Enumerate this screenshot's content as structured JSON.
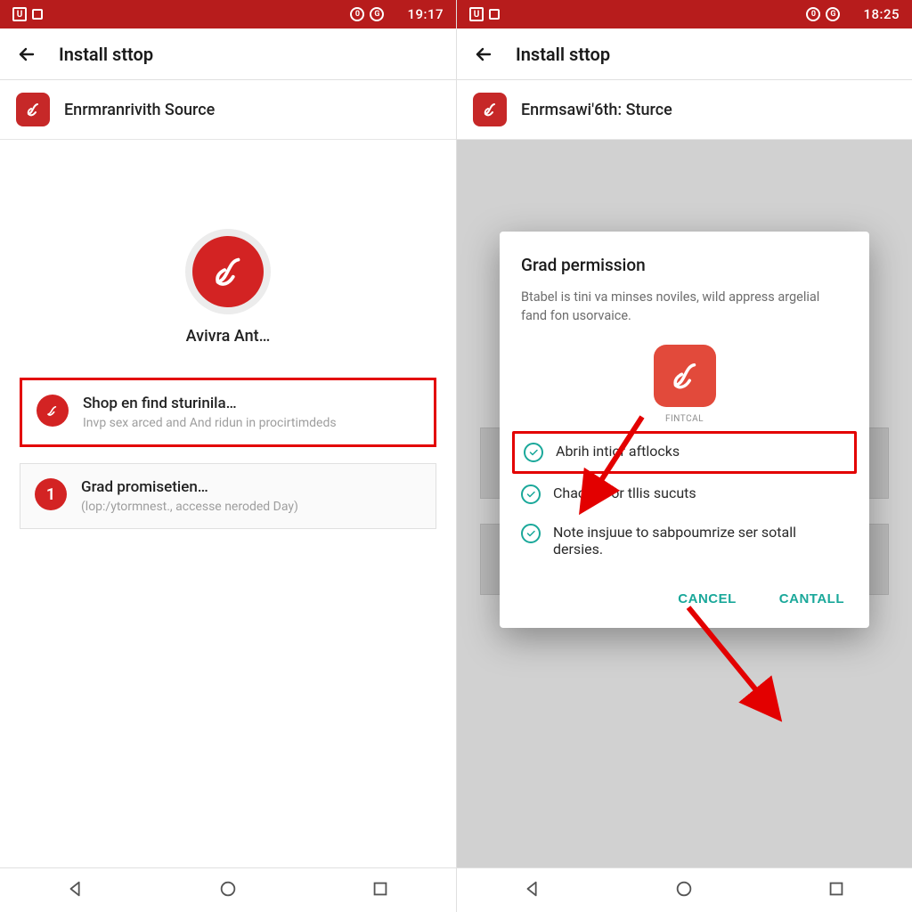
{
  "colors": {
    "status_bg": "#b71c1c",
    "brand": "#d32323",
    "highlight": "#e30000",
    "accent": "#1aa89a"
  },
  "left": {
    "status_time": "19:17",
    "header_title": "Install sttop",
    "source_label": "Enrmranrivith Source",
    "app_name": "Avivra Ant…",
    "cards": [
      {
        "title": "Shop en find sturinila…",
        "subtitle": "Invp sex arced and And ridun in procirtimdeds",
        "highlighted": true,
        "icon": "swirl"
      },
      {
        "title": "Grad promisetien…",
        "subtitle": "(lop:/ytormnest., accesse neroded Day)",
        "highlighted": false,
        "icon": "1"
      }
    ]
  },
  "right": {
    "status_time": "18:25",
    "header_title": "Install sttop",
    "source_label": "Enrmsawi'6th: Sturce",
    "dialog": {
      "title": "Grad permission",
      "desc": "Btabel is tini va minses noviles, wild appress argelial fand fon usorvaice.",
      "icon_caption": "FINTCAL",
      "perms": [
        {
          "label": "Abrih intior aftlocks",
          "highlighted": true
        },
        {
          "label": "Chacleal or tllis sucuts",
          "highlighted": false
        },
        {
          "label": "Note insjuue to sabpoumrize ser sotall dersies.",
          "highlighted": false
        }
      ],
      "cancel": "CANCEL",
      "confirm": "CANTALL"
    }
  }
}
